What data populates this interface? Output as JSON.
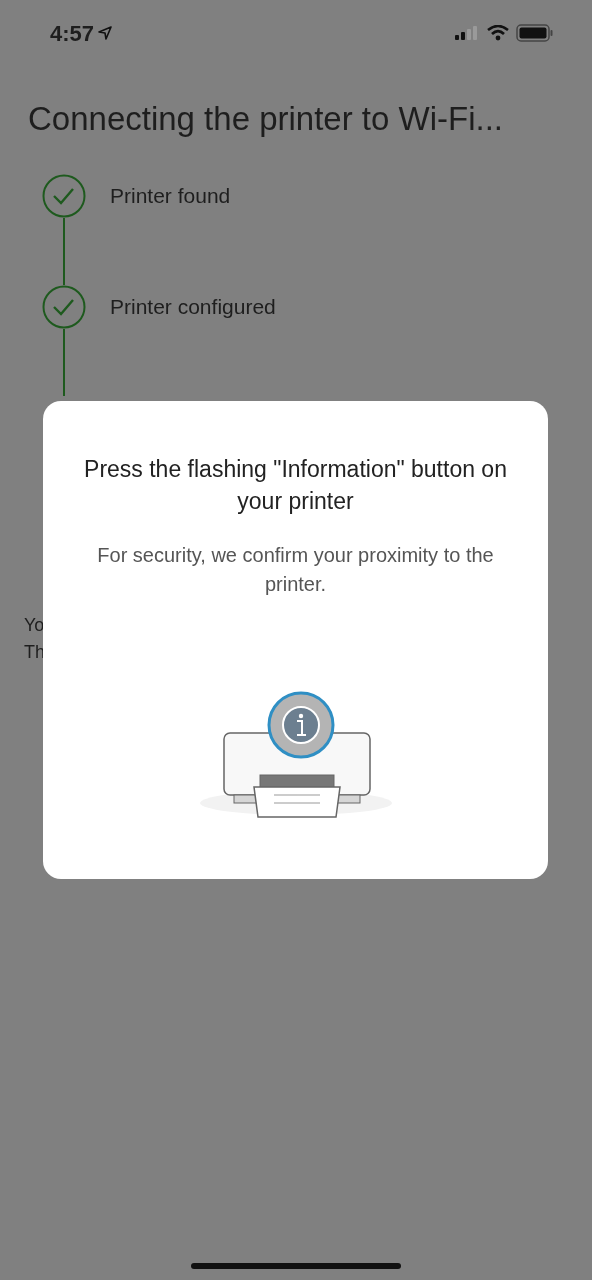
{
  "status_bar": {
    "time": "4:57"
  },
  "title": "Connecting the printer to Wi-Fi...",
  "steps": [
    {
      "label": "Printer found",
      "done": true
    },
    {
      "label": "Printer configured",
      "done": true
    }
  ],
  "background_lines": [
    "Yo",
    "Th"
  ],
  "dialog": {
    "title": "Press the flashing \"Information\" button on your printer",
    "message": "For security, we confirm your proximity to the printer."
  }
}
